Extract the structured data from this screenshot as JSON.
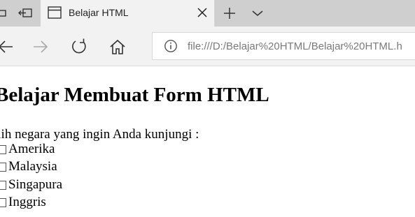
{
  "browser": {
    "tab_title": "Belajar HTML",
    "url": "file:///D:/Belajar%20HTML/Belajar%20HTML.h"
  },
  "page": {
    "heading": "Belajar Membuat Form HTML",
    "prompt": "ilih negara yang ingin Anda kunjungi :",
    "options": [
      {
        "label": "Amerika",
        "checked": false
      },
      {
        "label": "Malaysia",
        "checked": false
      },
      {
        "label": "Singapura",
        "checked": false
      },
      {
        "label": "Inggris",
        "checked": false
      }
    ]
  }
}
